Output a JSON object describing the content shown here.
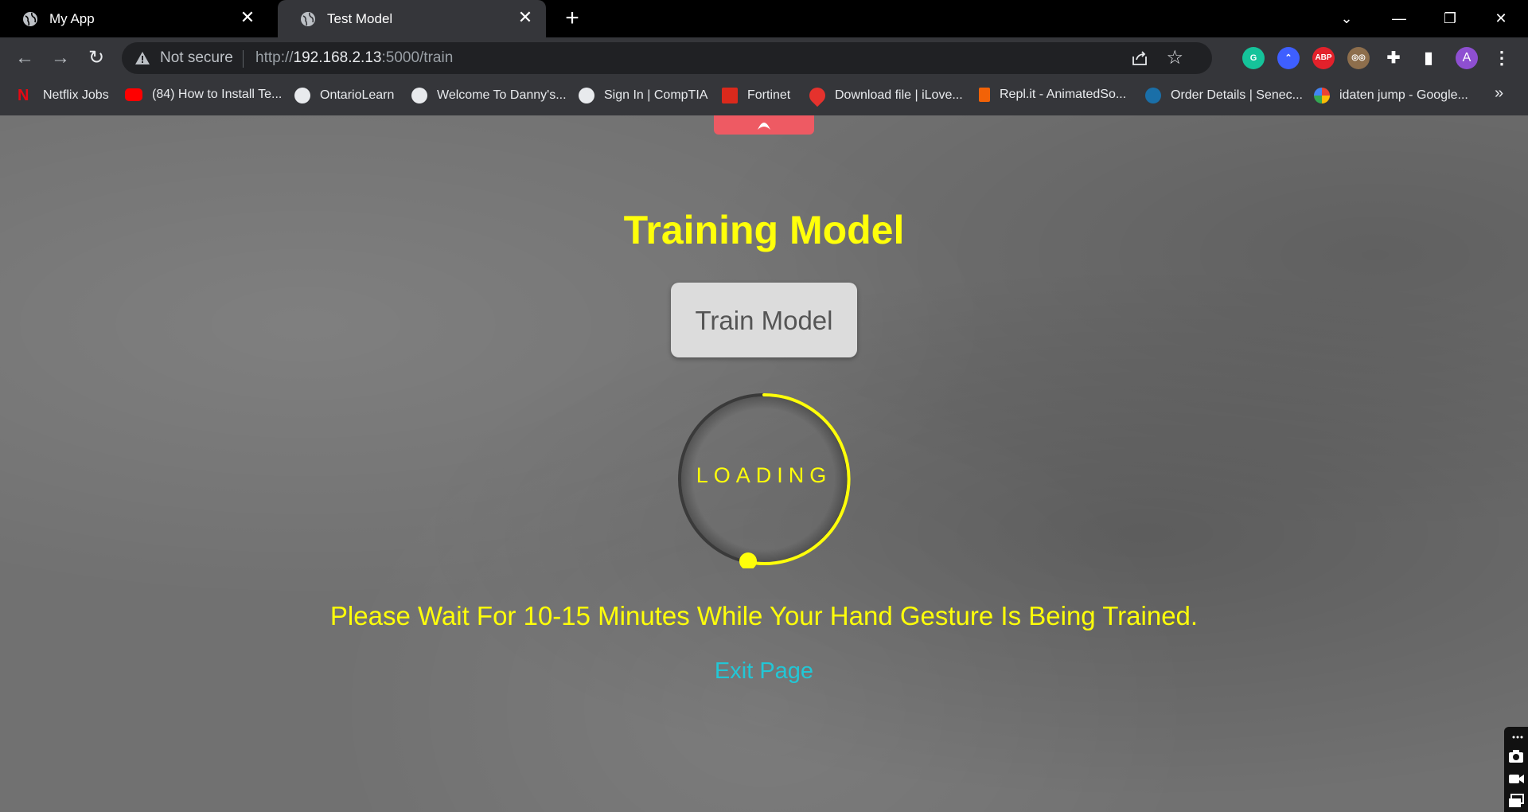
{
  "tabs": [
    {
      "title": "My App",
      "favicon": "globe-icon",
      "close": "✕"
    },
    {
      "title": "Test Model",
      "favicon": "globe-icon",
      "close": "✕"
    }
  ],
  "newtab_label": "+",
  "window": {
    "minimize": "—",
    "restore": "❐",
    "close": "✕",
    "tabsearch": "⌄"
  },
  "toolbar": {
    "back": "←",
    "forward": "→",
    "reload": "↻",
    "not_secure": "Not secure",
    "url_scheme": "http://",
    "url_host": "192.168.2.13",
    "url_rest": ":5000/train",
    "star": "☆"
  },
  "extensions": [
    {
      "name": "grammarly-icon",
      "label": "G",
      "color": "#15c39a"
    },
    {
      "name": "nordvpn-icon",
      "label": "⌃",
      "color": "#3e5fff"
    },
    {
      "name": "adblock-icon",
      "label": "ABP",
      "color": "#e3212b"
    },
    {
      "name": "owl-extension-icon",
      "label": "◎◎",
      "color": "#8d6e4c"
    },
    {
      "name": "puzzle-icon",
      "label": "✚",
      "color": "#35363a"
    },
    {
      "name": "sidepanel-icon",
      "label": "▮",
      "color": "#35363a"
    },
    {
      "name": "profile-avatar",
      "label": "A",
      "color": "#8e4fd1"
    },
    {
      "name": "menu-icon",
      "label": "⋮",
      "color": "#35363a"
    }
  ],
  "bookmarks": [
    {
      "label": "Netflix Jobs",
      "icon": "netflix-icon",
      "color": "#e50914"
    },
    {
      "label": "(84) How to Install Te...",
      "icon": "youtube-icon",
      "color": "#ff0000"
    },
    {
      "label": "OntarioLearn",
      "icon": "globe-icon",
      "color": "#e8eaed"
    },
    {
      "label": "Welcome To Danny's...",
      "icon": "globe-icon",
      "color": "#e8eaed"
    },
    {
      "label": "Sign In | CompTIA",
      "icon": "globe-icon",
      "color": "#e8eaed"
    },
    {
      "label": "Fortinet",
      "icon": "fortinet-icon",
      "color": "#da291c"
    },
    {
      "label": "Download file | iLove...",
      "icon": "ilovepdf-icon",
      "color": "#e5322d"
    },
    {
      "label": "Repl.it - AnimatedSo...",
      "icon": "replit-icon",
      "color": "#f26207"
    },
    {
      "label": "Order Details | Senec...",
      "icon": "oth-icon",
      "color": "#1a6fa8"
    },
    {
      "label": "idaten jump - Google...",
      "icon": "google-icon",
      "color": "#4285f4"
    }
  ],
  "bookmarks_overflow": "»",
  "page": {
    "heading": "Training Model",
    "train_button": "Train Model",
    "loading_label": "LOADING",
    "wait_message": "Please Wait For 10-15 Minutes While Your Hand Gesture Is Being Trained.",
    "exit_link": "Exit Page"
  },
  "colors": {
    "accent_yellow": "#ffff0a",
    "link_cyan": "#22c7d6",
    "top_tab": "#ee5a63"
  }
}
